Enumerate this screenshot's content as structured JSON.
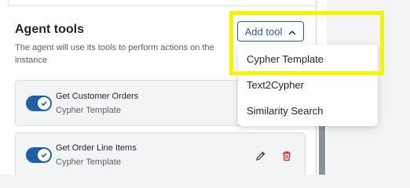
{
  "section": {
    "title": "Agent tools",
    "description": "The agent will use its tools to perform actions on the instance",
    "add_button_label": "Add tool"
  },
  "tools": [
    {
      "name": "Get Customer Orders",
      "type": "Cypher Template",
      "enabled": true
    },
    {
      "name": "Get Order Line Items",
      "type": "Cypher Template",
      "enabled": true
    }
  ],
  "dropdown": {
    "options": [
      "Cypher Template",
      "Text2Cypher",
      "Similarity Search"
    ],
    "highlighted_option": "Cypher Template"
  },
  "icons": {
    "chevron": "chevron-up-icon",
    "check": "check-icon",
    "edit": "pencil-icon",
    "delete": "trash-icon"
  },
  "colors": {
    "accent": "#1f5fa8",
    "danger": "#c8281e",
    "highlight": "#f5f500"
  }
}
